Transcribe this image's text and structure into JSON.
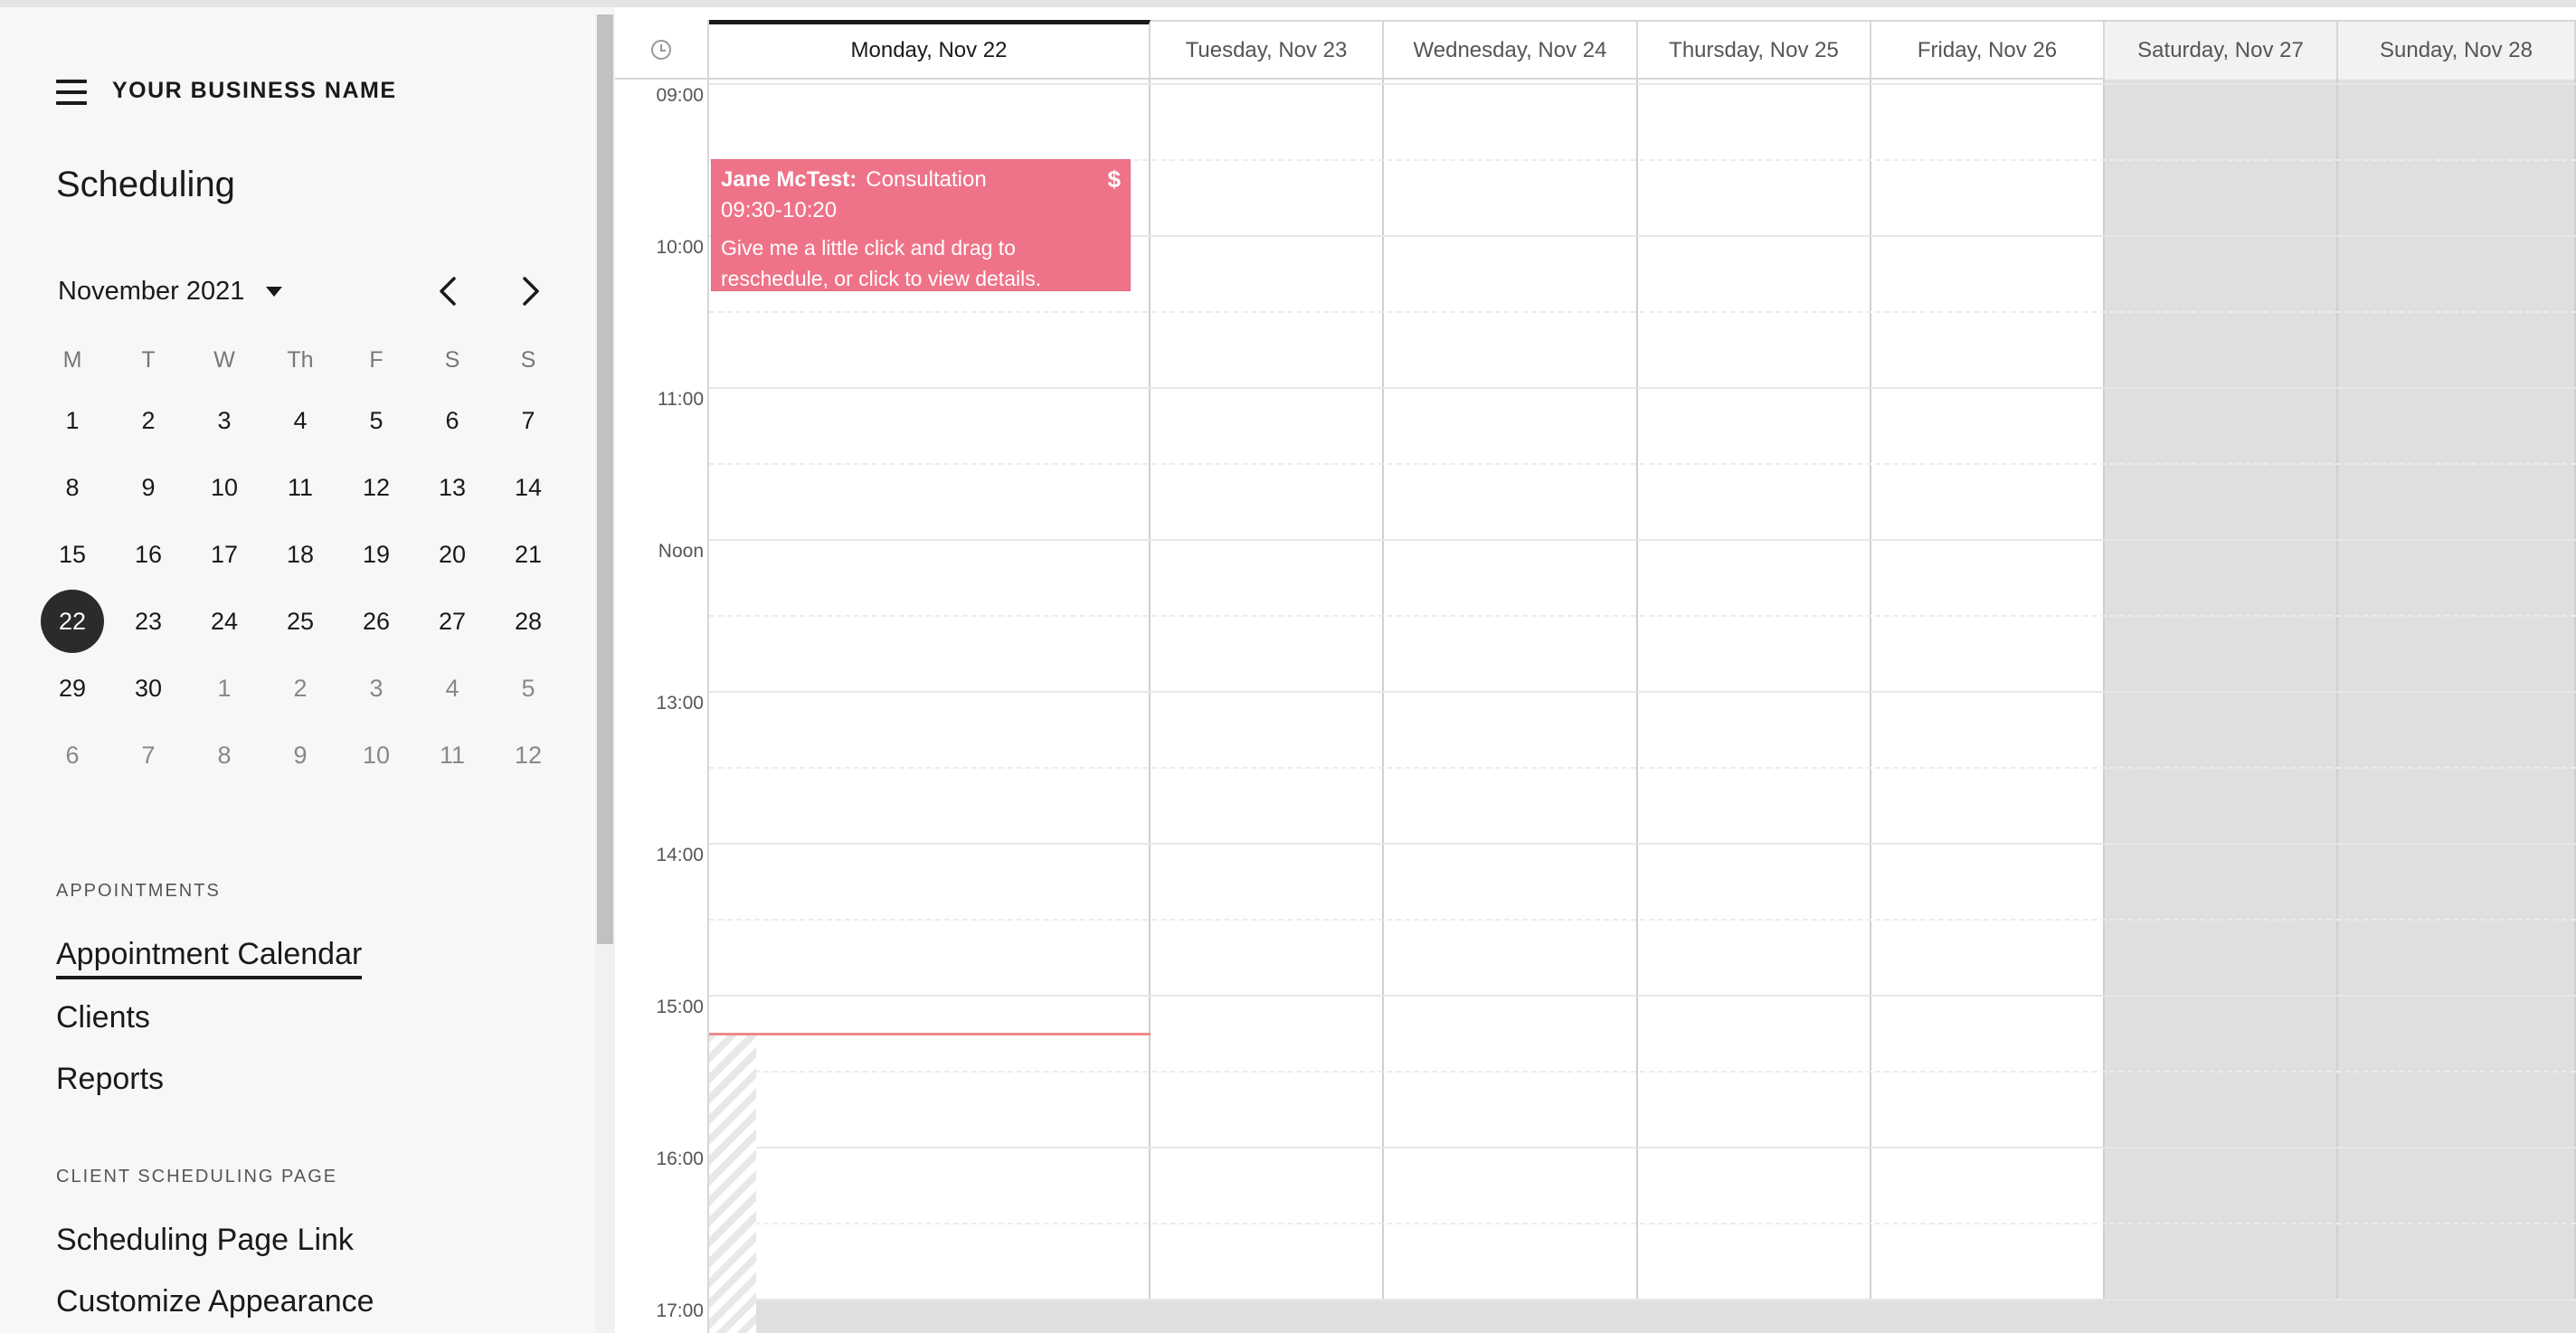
{
  "sidebar": {
    "business_name": "YOUR BUSINESS NAME",
    "app_title": "Scheduling",
    "mini_calendar": {
      "month_label": "November 2021",
      "weekdays": [
        "M",
        "T",
        "W",
        "Th",
        "F",
        "S",
        "S"
      ],
      "weeks": [
        [
          "1",
          "2",
          "3",
          "4",
          "5",
          "6",
          "7"
        ],
        [
          "8",
          "9",
          "10",
          "11",
          "12",
          "13",
          "14"
        ],
        [
          "15",
          "16",
          "17",
          "18",
          "19",
          "20",
          "21"
        ],
        [
          "22",
          "23",
          "24",
          "25",
          "26",
          "27",
          "28"
        ],
        [
          "29",
          "30",
          "1",
          "2",
          "3",
          "4",
          "5"
        ],
        [
          "6",
          "7",
          "8",
          "9",
          "10",
          "11",
          "12"
        ]
      ],
      "selected_day": "22"
    },
    "sections": {
      "appointments_label": "APPOINTMENTS",
      "appointment_calendar": "Appointment Calendar",
      "clients": "Clients",
      "reports": "Reports",
      "client_page_label": "CLIENT SCHEDULING PAGE",
      "scheduling_page_link": "Scheduling Page Link",
      "customize_appearance": "Customize Appearance"
    }
  },
  "calendar": {
    "days": [
      {
        "label": "Monday, Nov 22",
        "current": true,
        "weekend": false
      },
      {
        "label": "Tuesday, Nov 23",
        "current": false,
        "weekend": false
      },
      {
        "label": "Wednesday, Nov 24",
        "current": false,
        "weekend": false
      },
      {
        "label": "Thursday, Nov 25",
        "current": false,
        "weekend": false
      },
      {
        "label": "Friday, Nov 26",
        "current": false,
        "weekend": false
      },
      {
        "label": "Saturday, Nov 27",
        "current": false,
        "weekend": true
      },
      {
        "label": "Sunday, Nov 28",
        "current": false,
        "weekend": true
      }
    ],
    "hours": [
      "09:00",
      "10:00",
      "11:00",
      "Noon",
      "13:00",
      "14:00",
      "15:00",
      "16:00",
      "17:00"
    ],
    "event": {
      "client": "Jane McTest:",
      "service": "Consultation",
      "time": "09:30-10:20",
      "hint": "Give me a little click and drag to reschedule, or click to view details.",
      "paid_symbol": "$",
      "color": "#ef7388"
    },
    "current_time": "15:15"
  },
  "colors": {
    "sidebar_bg": "#f7f7f7",
    "event_pink": "#ef7388",
    "now_line": "#f08a8a",
    "weekend_bg": "#dfdfdf",
    "selected_day_bg": "#2b2b2b"
  }
}
